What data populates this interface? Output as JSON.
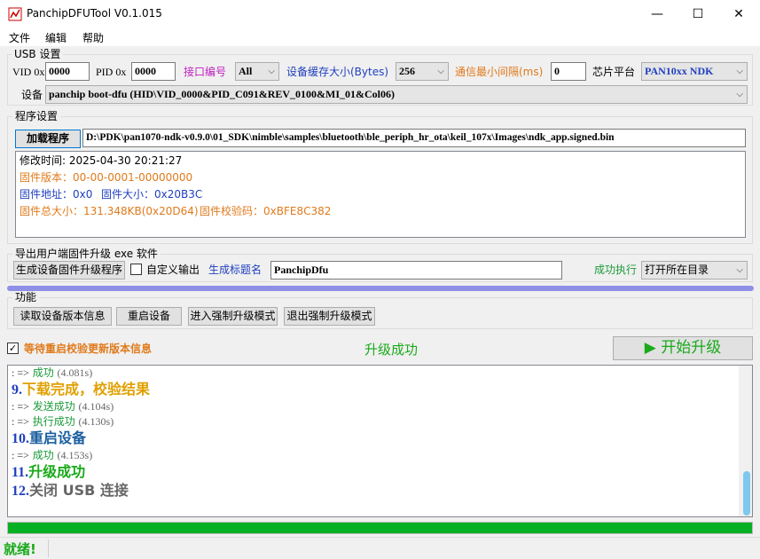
{
  "window": {
    "title": "PanchipDFUTool V0.1.015",
    "minimize": "—",
    "maximize": "☐",
    "close": "✕"
  },
  "menu": [
    "文件",
    "编辑",
    "帮助"
  ],
  "usb": {
    "group_title": "USB 设置",
    "vid_label": "VID 0x",
    "vid_value": "0000",
    "pid_label": "PID 0x",
    "pid_value": "0000",
    "port_label": "接口编号",
    "port_value": "All",
    "buffer_label": "设备缓存大小(Bytes)",
    "buffer_value": "256",
    "interval_label": "通信最小间隔(ms)",
    "interval_value": "0",
    "platform_label": "芯片平台",
    "platform_value": "PAN10xx NDK",
    "device_label": "设备",
    "device_value": "panchip boot-dfu (HID\\VID_0000&PID_C091&REV_0100&MI_01&Col06)"
  },
  "program": {
    "group_title": "程序设置",
    "load_button": "加载程序",
    "path_value": "D:\\PDK\\pan1070-ndk-v0.9.0\\01_SDK\\nimble\\samples\\bluetooth\\ble_periph_hr_ota\\keil_107x\\Images\\ndk_app.signed.bin",
    "info": {
      "modified": "修改时间: 2025-04-30 20:21:27",
      "version": "固件版本：00-00-0001-00000000",
      "address": "固件地址：0x0",
      "size": "固件大小：0x20B3C",
      "total": "固件总大小：131.348KB(0x20D64)",
      "checksum": "固件校验码：0xBFE8C382"
    }
  },
  "export": {
    "group_title": "导出用户端固件升级 exe 软件",
    "generate_button": "生成设备固件升级程序",
    "custom_output_label": "自定义输出",
    "custom_output_checked": false,
    "title_label": "生成标题名",
    "title_value": "PanchipDfu",
    "success_label": "成功执行",
    "success_action": "打开所在目录",
    "progress_color": "#8f8fe8"
  },
  "functions": {
    "group_title": "功能",
    "buttons": [
      "读取设备版本信息",
      "重启设备",
      "进入强制升级模式",
      "退出强制升级模式"
    ]
  },
  "upgrade": {
    "wait_label": "等待重启校验更新版本信息",
    "wait_checked": true,
    "status": "升级成功",
    "start_button": "▶ 开始升级"
  },
  "log": [
    {
      "style": "small",
      "arrow": ": =>",
      "text": "成功",
      "time": "(4.081s)"
    },
    {
      "style": "big",
      "num": "9.",
      "text": "下载完成，校验结果",
      "color": "#e0a000"
    },
    {
      "style": "small",
      "arrow": ": =>",
      "text": "发送成功",
      "time": "(4.104s)"
    },
    {
      "style": "small",
      "arrow": ": =>",
      "text": "执行成功",
      "time": "(4.130s)"
    },
    {
      "style": "big",
      "num": "10.",
      "text": "重启设备",
      "color": "#1a5fa0"
    },
    {
      "style": "small",
      "arrow": ": =>",
      "text": "成功",
      "time": "(4.153s)"
    },
    {
      "style": "big",
      "num": "11.",
      "text": "升级成功",
      "color": "#1aaa1a"
    },
    {
      "style": "big",
      "num": "12.",
      "text": "关闭 USB 连接",
      "color": "#666666"
    }
  ],
  "bottom_progress": 1.0,
  "status_bar": "就绪!"
}
